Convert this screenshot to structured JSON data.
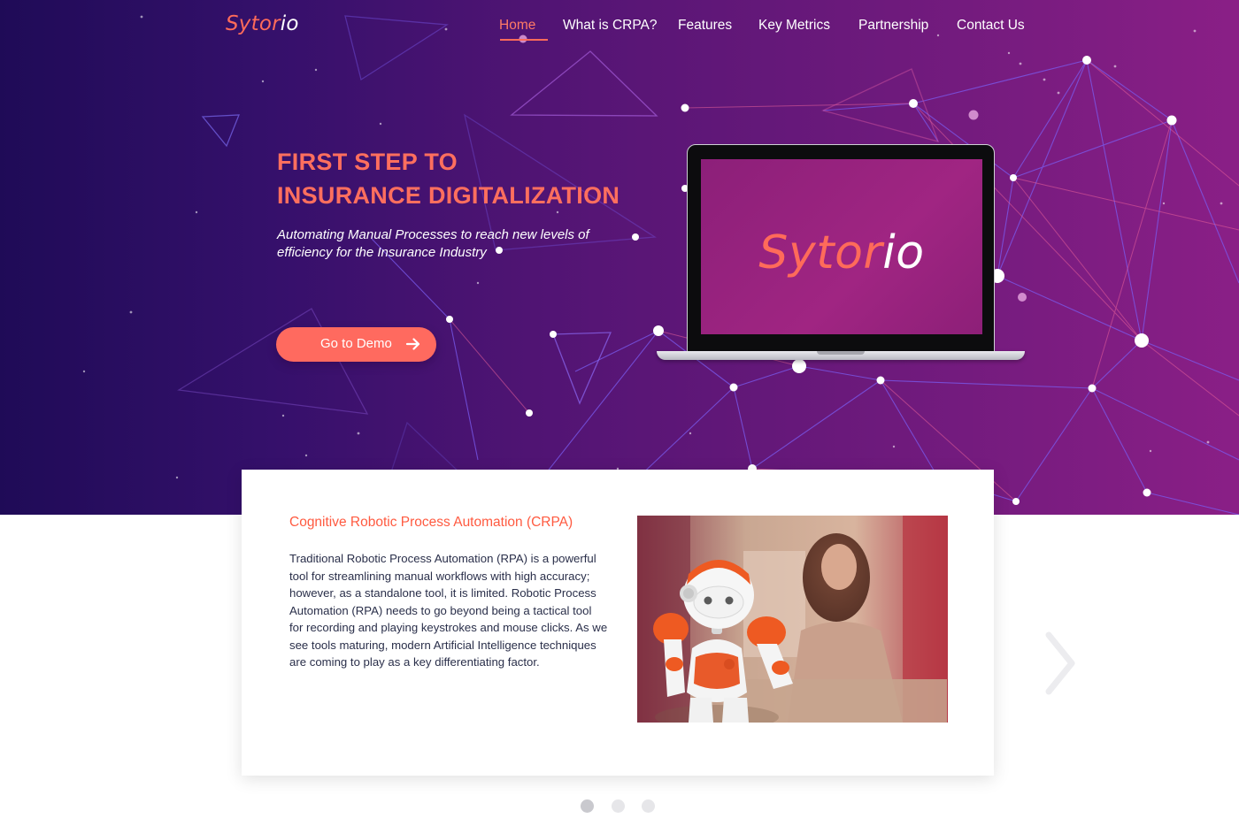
{
  "brand": {
    "logo_part1": "Sytor",
    "logo_part2": "io",
    "accent_color": "#ff6b5a"
  },
  "nav": {
    "items": [
      {
        "label": "Home",
        "active": true
      },
      {
        "label": "What is CRPA?",
        "active": false
      },
      {
        "label": "Features",
        "active": false
      },
      {
        "label": "Key Metrics",
        "active": false
      },
      {
        "label": "Partnership",
        "active": false
      },
      {
        "label": "Contact Us",
        "active": false
      }
    ]
  },
  "hero": {
    "title_line1": "FIRST STEP TO",
    "title_line2": "INSURANCE DIGITALIZATION",
    "subtitle_line1": "Automating Manual Processes to reach new levels of",
    "subtitle_line2": "efficiency for the Insurance Industry",
    "cta_label": "Go to Demo",
    "cta_icon": "arrow-right-icon",
    "gradient": [
      "#1f0b57",
      "#561575",
      "#8a1f86"
    ]
  },
  "laptop": {
    "screen_logo_part1": "Sytor",
    "screen_logo_part2": "io",
    "screen_color": "#9a2380"
  },
  "slide": {
    "title": "Cognitive Robotic Process Automation (CRPA)",
    "body": "Traditional Robotic Process Automation (RPA) is a powerful tool for streamlining manual workflows with high accuracy; however, as a standalone tool, it is limited. Robotic Process Automation (RPA) needs to go beyond being a tactical tool for recording and playing keystrokes and mouse clicks. As we see tools maturing, modern Artificial Intelligence techniques are coming to play as a key differentiating factor.",
    "image_icon": "robot-photo",
    "next_icon": "chevron-right-icon"
  },
  "carousel": {
    "total": 3,
    "active_index": 0
  }
}
